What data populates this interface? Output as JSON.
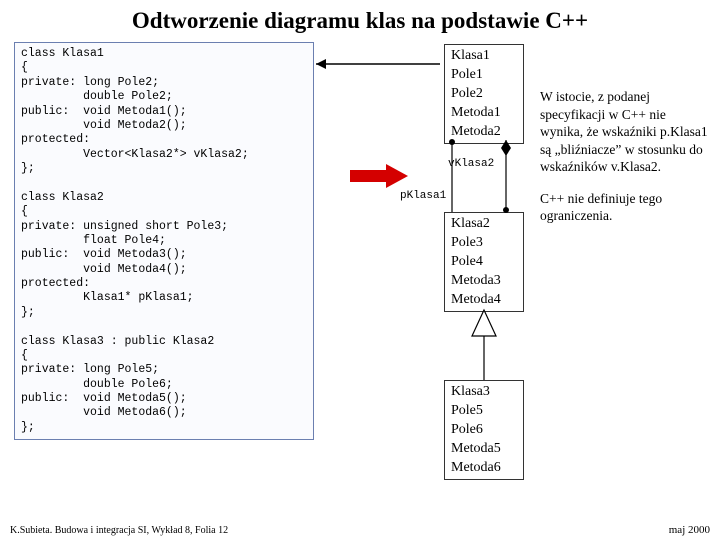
{
  "title": "Odtworzenie diagramu klas na podstawie C++",
  "code": "class Klasa1\n{\nprivate: long Pole2;\n         double Pole2;\npublic:  void Metoda1();\n         void Metoda2();\nprotected:\n         Vector<Klasa2*> vKlasa2;\n};\n\nclass Klasa2\n{\nprivate: unsigned short Pole3;\n         float Pole4;\npublic:  void Metoda3();\n         void Metoda4();\nprotected:\n         Klasa1* pKlasa1;\n};\n\nclass Klasa3 : public Klasa2\n{\nprivate: long Pole5;\n         double Pole6;\npublic:  void Metoda5();\n         void Metoda6();\n};",
  "uml": {
    "klasa1": [
      "Klasa1",
      "Pole1",
      "Pole2",
      "Metoda1",
      "Metoda2"
    ],
    "klasa2": [
      "Klasa2",
      "Pole3",
      "Pole4",
      "Metoda3",
      "Metoda4"
    ],
    "klasa3": [
      "Klasa3",
      "Pole5",
      "Pole6",
      "Metoda5",
      "Metoda6"
    ]
  },
  "labels": {
    "vklasa2": "vKlasa2",
    "pklasa1": "pKlasa1"
  },
  "commentary": {
    "p1": "W istocie, z podanej specyfikacji w C++ nie wynika, że wskaźniki p.Klasa1 są „bliźniacze” w stosunku do wskaźników v.Klasa2.",
    "p2": "C++ nie definiuje tego ograniczenia."
  },
  "footer": {
    "left": "K.Subieta. Budowa i integracja SI, Wykład 8, Folia 12",
    "right": "maj 2000"
  }
}
